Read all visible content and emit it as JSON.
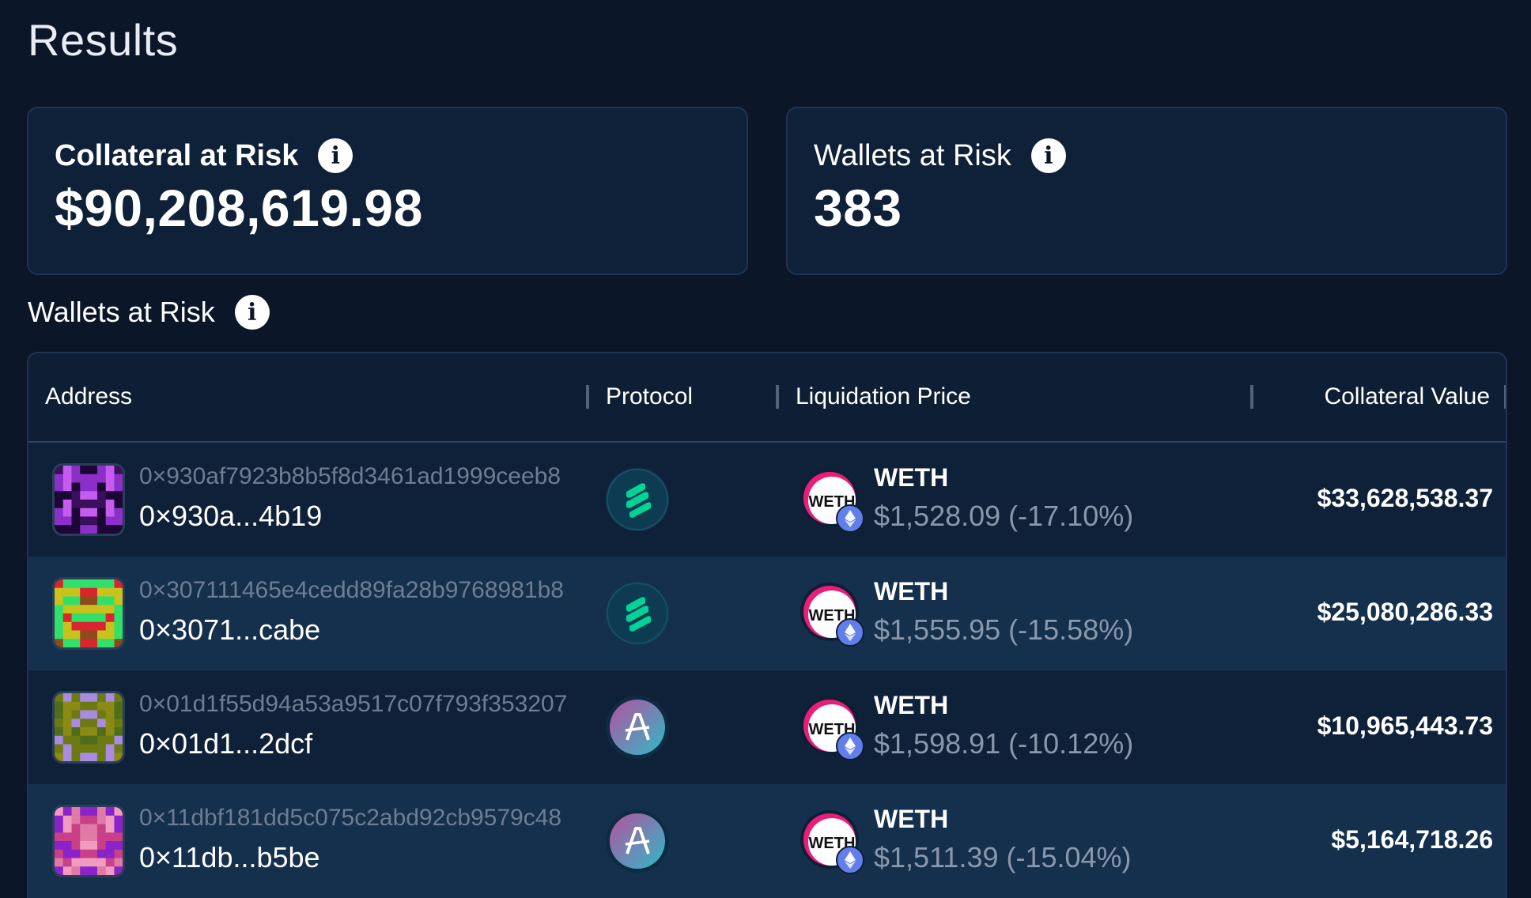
{
  "page": {
    "title": "Results"
  },
  "summary": {
    "collateral": {
      "label": "Collateral at Risk",
      "value": "$90,208,619.98",
      "info_icon": "info-icon"
    },
    "wallets": {
      "label": "Wallets at Risk",
      "value": "383",
      "info_icon": "info-icon"
    }
  },
  "section": {
    "label": "Wallets at Risk"
  },
  "table": {
    "columns": {
      "address": "Address",
      "protocol": "Protocol",
      "liquidation_price": "Liquidation Price",
      "collateral_value": "Collateral Value"
    },
    "rows": [
      {
        "address_full": "0×930af7923b8b5f8d3461ad1999ceeb8",
        "address_short": "0×930a...4b19",
        "protocol": "compound",
        "token": "WETH",
        "token_badge": "WETH",
        "liquidation_price": "$1,528.09 (-17.10%)",
        "collateral_value": "$33,628,538.37",
        "avatar_colors": [
          "#3a0f5e",
          "#8b2fc9",
          "#1c0633",
          "#c65bf0"
        ]
      },
      {
        "address_full": "0×307111465e4cedd89fa28b9768981b8",
        "address_short": "0×3071...cabe",
        "protocol": "compound",
        "token": "WETH",
        "token_badge": "WETH",
        "liquidation_price": "$1,555.95 (-15.58%)",
        "collateral_value": "$25,080,286.33",
        "avatar_colors": [
          "#d9262e",
          "#c8c21d",
          "#31e06a",
          "#8e4a1c"
        ]
      },
      {
        "address_full": "0×01d1f55d94a53a9517c07f793f353207",
        "address_short": "0×01d1...2dcf",
        "protocol": "aave",
        "token": "WETH",
        "token_badge": "WETH",
        "liquidation_price": "$1,598.91 (-10.12%)",
        "collateral_value": "$10,965,443.73",
        "avatar_colors": [
          "#8a8a14",
          "#4f6e1a",
          "#a98be0",
          "#6d7a12"
        ]
      },
      {
        "address_full": "0×11dbf181dd5c075c2abd92cb9579c48",
        "address_short": "0×11db...b5be",
        "protocol": "aave",
        "token": "WETH",
        "token_badge": "WETH",
        "liquidation_price": "$1,511.39 (-15.04%)",
        "collateral_value": "$5,164,718.26",
        "avatar_colors": [
          "#e07aa6",
          "#8a23c9",
          "#f29bc0",
          "#c94089"
        ]
      }
    ]
  }
}
